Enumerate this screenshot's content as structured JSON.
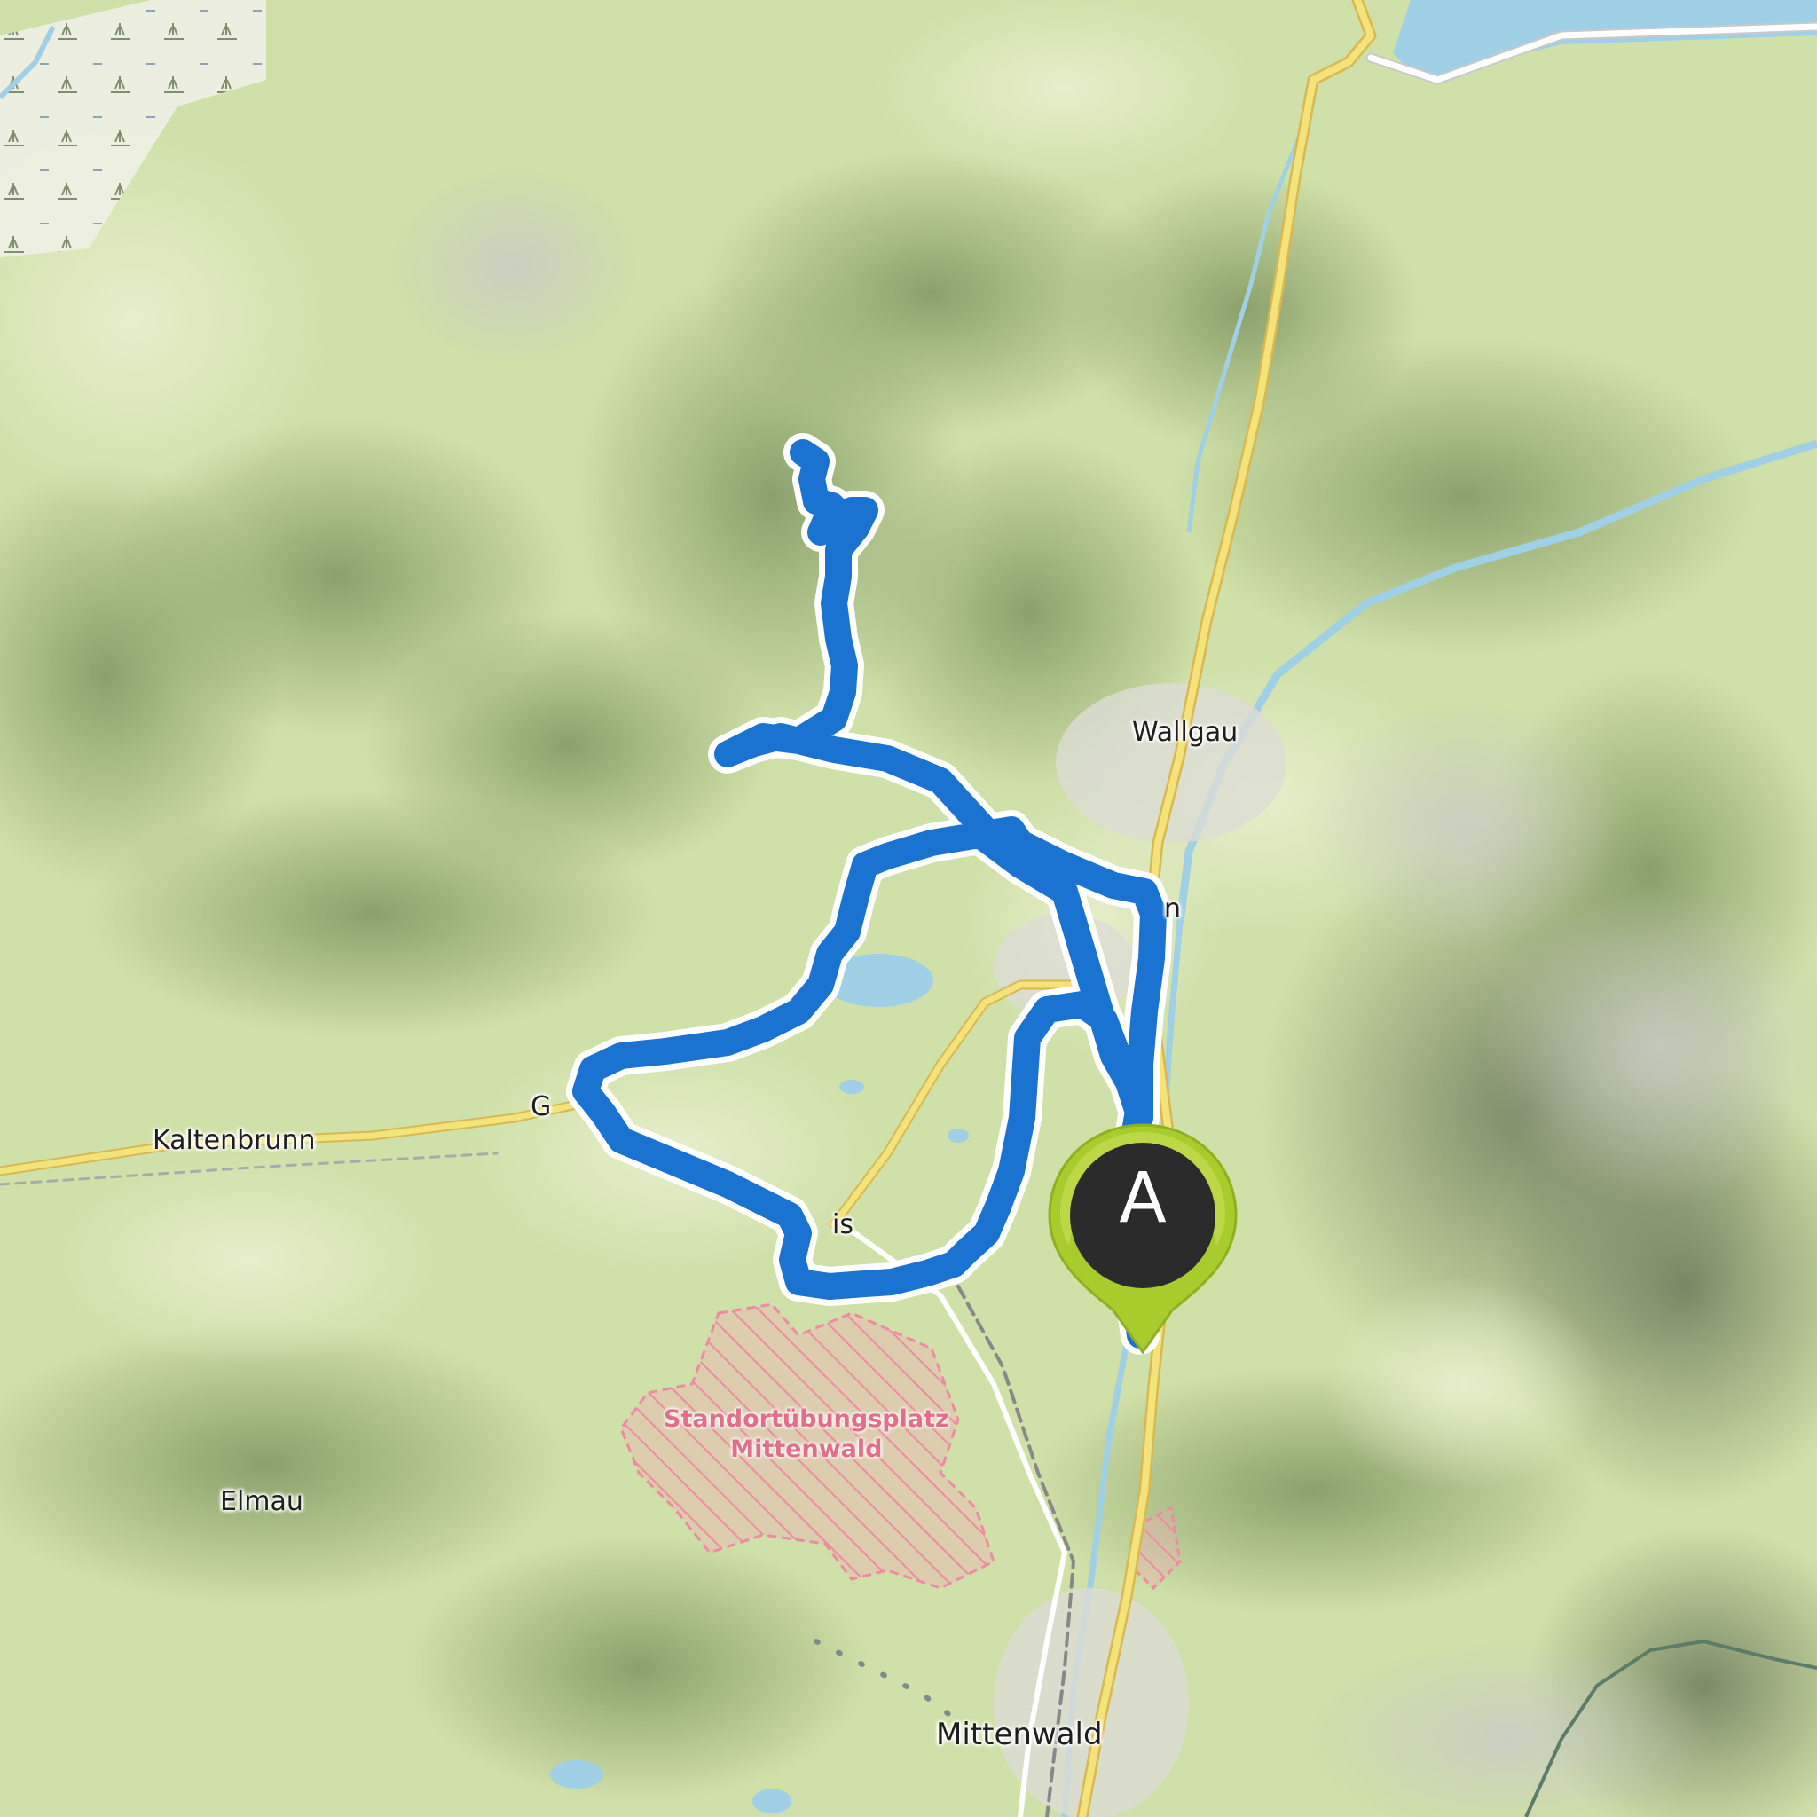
{
  "map": {
    "place_labels": {
      "wallgau": "Wallgau",
      "kaltenbrunn": "Kaltenbrunn",
      "elmau": "Elmau",
      "mittenwald": "Mittenwald",
      "partial_g": "G",
      "partial_is": "is",
      "partial_n": "n"
    },
    "restricted_zone": {
      "line1": "Standortübungsplatz",
      "line2": "Mittenwald"
    },
    "route": {
      "color": "#1a73d1",
      "outline_color": "#ffffff"
    },
    "start_marker": {
      "letter": "A",
      "pin_color": "#a8cc2c",
      "inner_color": "#2b2b2b"
    },
    "colors": {
      "terrain": "#cfe0a8",
      "forest_shade": "#8da36a",
      "water": "#9fd0e6",
      "road_main": "#f4e27a",
      "road_casing": "#d8b850",
      "restricted_zone": "#f3a9bb"
    }
  }
}
